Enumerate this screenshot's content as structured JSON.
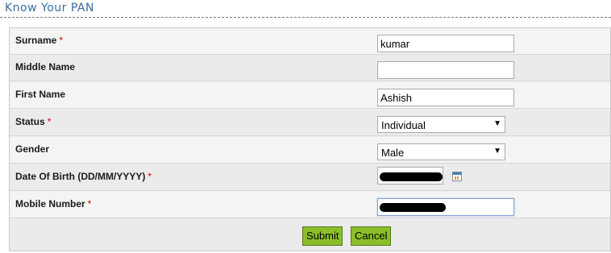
{
  "page": {
    "title": "Know Your PAN"
  },
  "form": {
    "fields": [
      {
        "label": "Surname",
        "required": "*",
        "value": "kumar",
        "type": "text"
      },
      {
        "label": "Middle Name",
        "required": "",
        "value": "",
        "type": "text"
      },
      {
        "label": "First Name",
        "required": "",
        "value": "Ashish",
        "type": "text"
      },
      {
        "label": "Status",
        "required": "*",
        "value": "Individual",
        "type": "select"
      },
      {
        "label": "Gender",
        "required": "",
        "value": "Male",
        "type": "select"
      },
      {
        "label": "Date Of Birth (DD/MM/YYYY)",
        "required": "*",
        "value": "[redacted]",
        "type": "date",
        "icon": "calendar-icon"
      },
      {
        "label": "Mobile Number",
        "required": "*",
        "value": "[redacted]",
        "type": "text"
      }
    ],
    "buttons": {
      "submit": "Submit",
      "cancel": "Cancel"
    }
  },
  "colors": {
    "title": "#3a6ea5",
    "required": "#cc0000",
    "button_bg": "#8bbf2a",
    "button_border": "#4f7a13"
  }
}
